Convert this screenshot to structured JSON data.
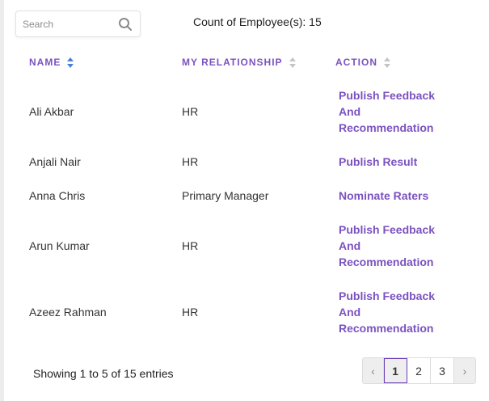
{
  "search": {
    "placeholder": "Search"
  },
  "count_label": "Count of Employee(s): 15",
  "columns": [
    "NAME",
    "MY RELATIONSHIP",
    "ACTION"
  ],
  "rows": [
    {
      "name": "Ali Akbar",
      "relationship": "HR",
      "action": [
        "Publish Feedback",
        "And",
        "Recommendation"
      ]
    },
    {
      "name": "Anjali Nair",
      "relationship": "HR",
      "action": [
        "Publish Result"
      ]
    },
    {
      "name": "Anna Chris",
      "relationship": "Primary Manager",
      "action": [
        "Nominate Raters"
      ]
    },
    {
      "name": "Arun Kumar",
      "relationship": "HR",
      "action": [
        "Publish Feedback",
        "And",
        "Recommendation"
      ]
    },
    {
      "name": "Azeez Rahman",
      "relationship": "HR",
      "action": [
        "Publish Feedback",
        "And",
        "Recommendation"
      ]
    }
  ],
  "footer": {
    "info": "Showing 1 to 5 of 15 entries"
  },
  "pagination": {
    "prev": "‹",
    "pages": [
      "1",
      "2",
      "3"
    ],
    "next": "›",
    "active_page": "1"
  },
  "colors": {
    "accent": "#7b52c0",
    "active_sort": "#4a7fd6"
  }
}
